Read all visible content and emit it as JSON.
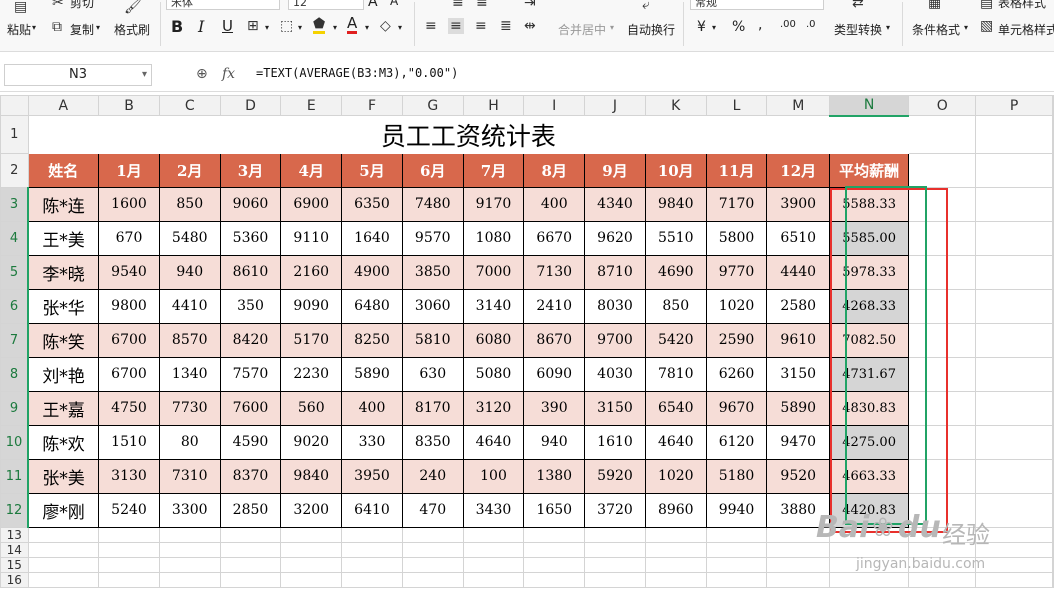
{
  "ribbon": {
    "font_name": "宋体",
    "font_size": "12",
    "number_format": "常规",
    "paste": "粘贴",
    "cut": "剪切",
    "copy": "复制",
    "format_painter": "格式刷",
    "merge_center": "合并居中",
    "wrap_text": "自动换行",
    "type_convert": "类型转换",
    "conditional_format": "条件格式",
    "cell_style": "单元格样式",
    "table_style": "表格样式",
    "bold": "B",
    "italic": "I",
    "underline": "U",
    "currency": "¥",
    "percent": "%",
    "thousands": ",",
    "inc_decimal": ".00",
    "dec_decimal": ".0"
  },
  "formula_bar": {
    "cell_ref": "N3",
    "fx": "fx",
    "formula": "=TEXT(AVERAGE(B3:M3),\"0.00\")"
  },
  "columns": [
    "A",
    "B",
    "C",
    "D",
    "E",
    "F",
    "G",
    "H",
    "I",
    "J",
    "K",
    "L",
    "M",
    "N",
    "O",
    "P"
  ],
  "row_numbers": [
    "1",
    "2",
    "3",
    "4",
    "5",
    "6",
    "7",
    "8",
    "9",
    "10",
    "11",
    "12",
    "13",
    "14",
    "15",
    "16"
  ],
  "sheet": {
    "title": "员工工资统计表",
    "headers": [
      "姓名",
      "1月",
      "2月",
      "3月",
      "4月",
      "5月",
      "6月",
      "7月",
      "8月",
      "9月",
      "10月",
      "11月",
      "12月",
      "平均薪酬"
    ],
    "rows": [
      [
        "陈*连",
        "1600",
        "850",
        "9060",
        "6900",
        "6350",
        "7480",
        "9170",
        "400",
        "4340",
        "9840",
        "7170",
        "3900",
        "5588.33"
      ],
      [
        "王*美",
        "670",
        "5480",
        "5360",
        "9110",
        "1640",
        "9570",
        "1080",
        "6670",
        "9620",
        "5510",
        "5800",
        "6510",
        "5585.00"
      ],
      [
        "李*晓",
        "9540",
        "940",
        "8610",
        "2160",
        "4900",
        "3850",
        "7000",
        "7130",
        "8710",
        "4690",
        "9770",
        "4440",
        "5978.33"
      ],
      [
        "张*华",
        "9800",
        "4410",
        "350",
        "9090",
        "6480",
        "3060",
        "3140",
        "2410",
        "8030",
        "850",
        "1020",
        "2580",
        "4268.33"
      ],
      [
        "陈*笑",
        "6700",
        "8570",
        "8420",
        "5170",
        "8250",
        "5810",
        "6080",
        "8670",
        "9700",
        "5420",
        "2590",
        "9610",
        "7082.50"
      ],
      [
        "刘*艳",
        "6700",
        "1340",
        "7570",
        "2230",
        "5890",
        "630",
        "5080",
        "6090",
        "4030",
        "7810",
        "6260",
        "3150",
        "4731.67"
      ],
      [
        "王*嘉",
        "4750",
        "7730",
        "7600",
        "560",
        "400",
        "8170",
        "3120",
        "390",
        "3150",
        "6540",
        "9670",
        "5890",
        "4830.83"
      ],
      [
        "陈*欢",
        "1510",
        "80",
        "4590",
        "9020",
        "330",
        "8350",
        "4640",
        "940",
        "1610",
        "4640",
        "6120",
        "9470",
        "4275.00"
      ],
      [
        "张*美",
        "3130",
        "7310",
        "8370",
        "9840",
        "3950",
        "240",
        "100",
        "1380",
        "5920",
        "1020",
        "5180",
        "9520",
        "4663.33"
      ],
      [
        "廖*刚",
        "5240",
        "3300",
        "2850",
        "3200",
        "6410",
        "470",
        "3430",
        "1650",
        "3720",
        "8960",
        "9940",
        "3880",
        "4420.83"
      ]
    ]
  },
  "watermark": {
    "brand": "Bai",
    "brand2": "du",
    "cn": "经验",
    "url": "jingyan.baidu.com"
  }
}
